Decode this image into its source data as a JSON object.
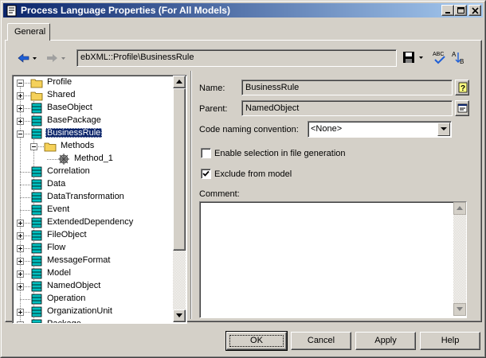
{
  "window": {
    "title": "Process Language Properties (For All Models)"
  },
  "tabs": [
    {
      "label": "General",
      "active": true
    }
  ],
  "toolbar": {
    "path": "ebXML::Profile\\BusinessRule"
  },
  "tree": {
    "items": [
      {
        "label": "Profile",
        "icon": "folder-icon",
        "expander": "minus"
      },
      {
        "label": "Shared",
        "icon": "folder-icon",
        "expander": "plus"
      },
      {
        "label": "BaseObject",
        "icon": "metaclass-icon",
        "expander": "plus"
      },
      {
        "label": "BasePackage",
        "icon": "metaclass-icon",
        "expander": "plus"
      },
      {
        "label": "BusinessRule",
        "icon": "metaclass-icon",
        "expander": "minus",
        "selected": true
      },
      {
        "label": "Methods",
        "icon": "folder-icon",
        "expander": "minus"
      },
      {
        "label": "Method_1",
        "icon": "method-gear-icon",
        "expander": "none"
      },
      {
        "label": "Correlation",
        "icon": "metaclass-icon",
        "expander": "none"
      },
      {
        "label": "Data",
        "icon": "metaclass-icon",
        "expander": "none"
      },
      {
        "label": "DataTransformation",
        "icon": "metaclass-icon",
        "expander": "none"
      },
      {
        "label": "Event",
        "icon": "metaclass-icon",
        "expander": "none"
      },
      {
        "label": "ExtendedDependency",
        "icon": "metaclass-icon",
        "expander": "plus"
      },
      {
        "label": "FileObject",
        "icon": "metaclass-icon",
        "expander": "plus"
      },
      {
        "label": "Flow",
        "icon": "metaclass-icon",
        "expander": "plus"
      },
      {
        "label": "MessageFormat",
        "icon": "metaclass-icon",
        "expander": "plus"
      },
      {
        "label": "Model",
        "icon": "metaclass-icon",
        "expander": "plus"
      },
      {
        "label": "NamedObject",
        "icon": "metaclass-icon",
        "expander": "plus"
      },
      {
        "label": "Operation",
        "icon": "metaclass-icon",
        "expander": "none"
      },
      {
        "label": "OrganizationUnit",
        "icon": "metaclass-icon",
        "expander": "plus"
      },
      {
        "label": "Package",
        "icon": "metaclass-icon",
        "expander": "plus"
      }
    ]
  },
  "form": {
    "name_label": "Name:",
    "name_value": "BusinessRule",
    "parent_label": "Parent:",
    "parent_value": "NamedObject",
    "code_naming_label": "Code naming convention:",
    "code_naming_value": "<None>",
    "enable_selection_label": "Enable selection in file generation",
    "enable_selection_checked": false,
    "exclude_label": "Exclude from model",
    "exclude_checked": true,
    "comment_label": "Comment:",
    "comment_value": ""
  },
  "buttons": {
    "ok": "OK",
    "cancel": "Cancel",
    "apply": "Apply",
    "help": "Help"
  },
  "colors": {
    "title_start": "#0a246a",
    "title_end": "#a6caf0",
    "face": "#d4d0c8",
    "selection": "#0a246a",
    "folder": "#f5d15a",
    "metaclass": "#00c0c0"
  }
}
